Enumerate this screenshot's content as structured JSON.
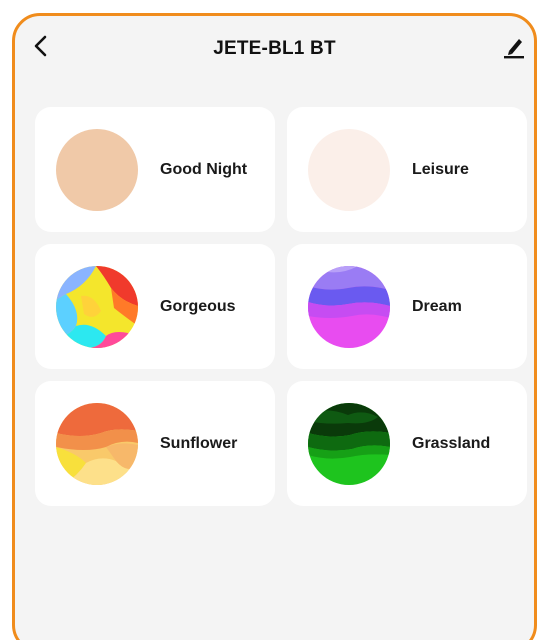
{
  "header": {
    "title": "JETE-BL1 BT",
    "back_icon": "chevron-left-icon",
    "edit_icon": "pencil-icon"
  },
  "scenes": [
    {
      "label": "Good Night",
      "swatch": "peach-solid",
      "color": "#f0c9a8"
    },
    {
      "label": "Leisure",
      "swatch": "blush-solid",
      "color": "#fbefe9"
    },
    {
      "label": "Gorgeous",
      "swatch": "rainbow-gradient"
    },
    {
      "label": "Dream",
      "swatch": "purple-magenta-gradient"
    },
    {
      "label": "Sunflower",
      "swatch": "orange-yellow-gradient"
    },
    {
      "label": "Grassland",
      "swatch": "green-gradient"
    }
  ],
  "colors": {
    "accent_border": "#f08c1c",
    "background": "#f4f4f4",
    "card": "#ffffff"
  }
}
